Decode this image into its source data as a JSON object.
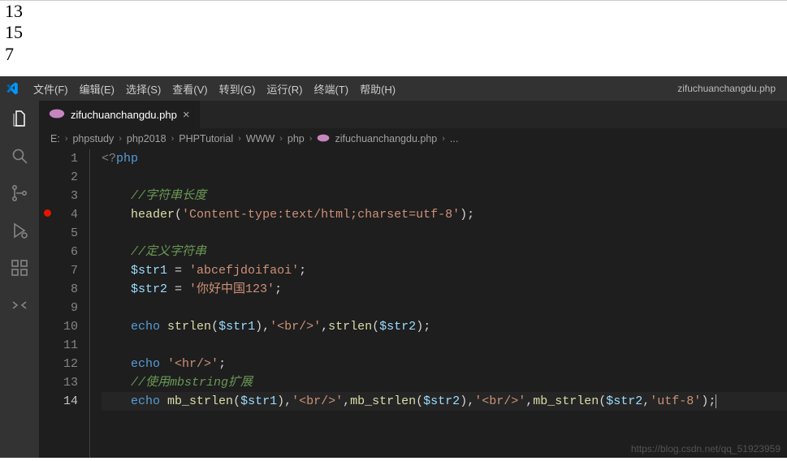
{
  "output": {
    "l1": "13",
    "l2": "15",
    "l3": "7"
  },
  "menu": {
    "file": "文件(F)",
    "edit": "编辑(E)",
    "select": "选择(S)",
    "view": "查看(V)",
    "go": "转到(G)",
    "run": "运行(R)",
    "terminal": "终端(T)",
    "help": "帮助(H)"
  },
  "window_title": "zifuchuanchangdu.php",
  "tab": {
    "filename": "zifuchuanchangdu.php",
    "close": "×"
  },
  "breadcrumbs": {
    "root": "E:",
    "p1": "phpstudy",
    "p2": "php2018",
    "p3": "PHPTutorial",
    "p4": "WWW",
    "p5": "php",
    "file": "zifuchuanchangdu.php",
    "tail": "..."
  },
  "code": {
    "total_lines": 14,
    "current_line": 14,
    "breakpoint_line": 4,
    "l1_open": "<?",
    "l1_php": "php",
    "l3_c": "//字符串长度",
    "l4_fn": "header",
    "l4_s": "'Content-type:text/html;charset=utf-8'",
    "l6_c": "//定义字符串",
    "l7_v": "$str1",
    "l7_s": "'abcefjdoifaoi'",
    "l8_v": "$str2",
    "l8_s": "'你好中国123'",
    "l10_kw": "echo",
    "l10_fn": "strlen",
    "l10_v1": "$str1",
    "l10_br": "'<br/>'",
    "l10_v2": "$str2",
    "l12_kw": "echo",
    "l12_s": "'<hr/>'",
    "l13_c": "//使用mbstring扩展",
    "l14_kw": "echo",
    "l14_fn": "mb_strlen",
    "l14_v1": "$str1",
    "l14_br": "'<br/>'",
    "l14_v2": "$str2",
    "l14_enc": "'utf-8'"
  },
  "watermark": "https://blog.csdn.net/qq_51923959"
}
